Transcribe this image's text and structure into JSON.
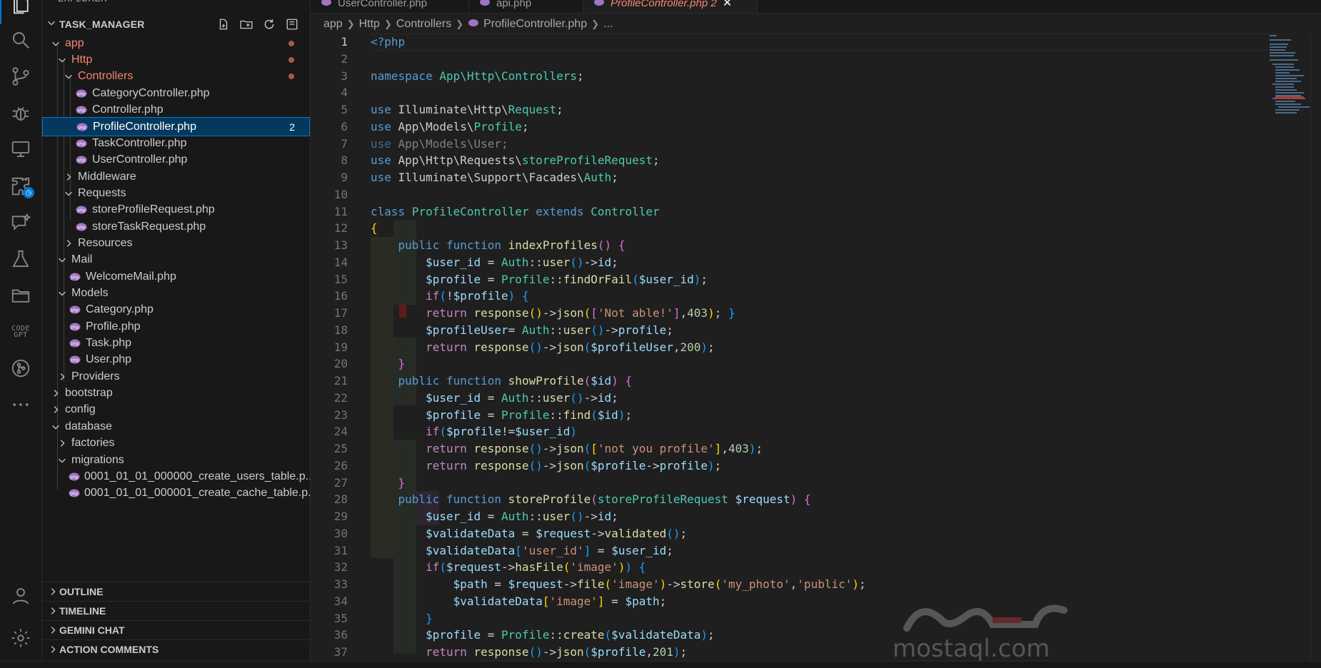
{
  "sidebar": {
    "top_label": "EXPLORER",
    "project": "TASK_MANAGER",
    "tree": [
      {
        "label": "app"
      },
      {
        "label": "Http"
      },
      {
        "label": "Controllers"
      },
      {
        "label": "CategoryController.php"
      },
      {
        "label": "Controller.php"
      },
      {
        "label": "ProfileController.php",
        "count": "2"
      },
      {
        "label": "TaskController.php"
      },
      {
        "label": "UserController.php"
      },
      {
        "label": "Middleware"
      },
      {
        "label": "Requests"
      },
      {
        "label": "storeProfileRequest.php"
      },
      {
        "label": "storeTaskRequest.php"
      },
      {
        "label": "Resources"
      },
      {
        "label": "Mail"
      },
      {
        "label": "WelcomeMail.php"
      },
      {
        "label": "Models"
      },
      {
        "label": "Category.php"
      },
      {
        "label": "Profile.php"
      },
      {
        "label": "Task.php"
      },
      {
        "label": "User.php"
      },
      {
        "label": "Providers"
      },
      {
        "label": "bootstrap"
      },
      {
        "label": "config"
      },
      {
        "label": "database"
      },
      {
        "label": "factories"
      },
      {
        "label": "migrations"
      },
      {
        "label": "0001_01_01_000000_create_users_table.p..."
      },
      {
        "label": "0001_01_01_000001_create_cache_table.p..."
      }
    ],
    "panels": [
      "OUTLINE",
      "TIMELINE",
      "GEMINI CHAT",
      "ACTION COMMENTS"
    ]
  },
  "activity": {
    "codegpt_label": "CODE GPT"
  },
  "tabs": [
    {
      "label": "UserController.php"
    },
    {
      "label": "api.php"
    },
    {
      "label": "ProfileController.php 2"
    }
  ],
  "breadcrumb": [
    "app",
    "Http",
    "Controllers",
    "ProfileController.php",
    "..."
  ],
  "code": {
    "line_numbers": [
      "1",
      "2",
      "3",
      "4",
      "5",
      "6",
      "7",
      "8",
      "9",
      "10",
      "11",
      "12",
      "13",
      "14",
      "15",
      "16",
      "17",
      "18",
      "19",
      "20",
      "21",
      "22",
      "23",
      "24",
      "25",
      "26",
      "27",
      "28",
      "29",
      "30",
      "31",
      "32",
      "33",
      "34",
      "35",
      "36",
      "37"
    ]
  },
  "watermark": {
    "text": "mostaql.com"
  },
  "colors": {
    "accent": "#0078d4",
    "git_modified": "#f48771",
    "editor_bg": "#1f1f1f"
  }
}
